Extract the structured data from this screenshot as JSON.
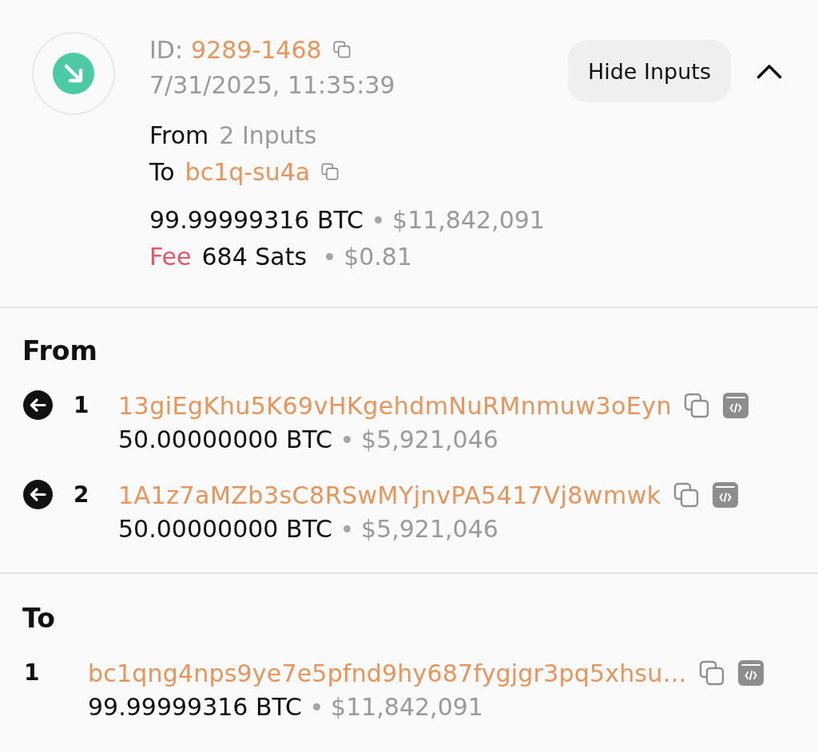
{
  "header": {
    "id_label": "ID:",
    "id": "9289-1468",
    "datetime": "7/31/2025, 11:35:39",
    "from_label": "From",
    "from_value": "2 Inputs",
    "to_label": "To",
    "to_value": "bc1q-su4a",
    "amount": "99.99999316 BTC",
    "amount_usd": "$11,842,091",
    "fee_label": "Fee",
    "fee": "684 Sats",
    "fee_usd": "$0.81"
  },
  "toggle": {
    "label": "Hide Inputs",
    "expanded": true
  },
  "sections": [
    {
      "title": "From",
      "kind": "inputs",
      "entries": [
        {
          "index": "1",
          "address": "13giEgKhu5K69vHKgehdmNuRMnmuw3oEyn",
          "amount": "50.00000000 BTC",
          "amount_usd": "$5,921,046"
        },
        {
          "index": "2",
          "address": "1A1z7aMZb3sC8RSwMYjnvPA5417Vj8wmwk",
          "amount": "50.00000000 BTC",
          "amount_usd": "$5,921,046"
        }
      ]
    },
    {
      "title": "To",
      "kind": "outputs",
      "entries": [
        {
          "index": "1",
          "address": "bc1qng4nps9ye7e5pfnd9hy687fygjgr3pq5xhsu…",
          "amount": "99.99999316 BTC",
          "amount_usd": "$11,842,091"
        }
      ]
    }
  ]
}
